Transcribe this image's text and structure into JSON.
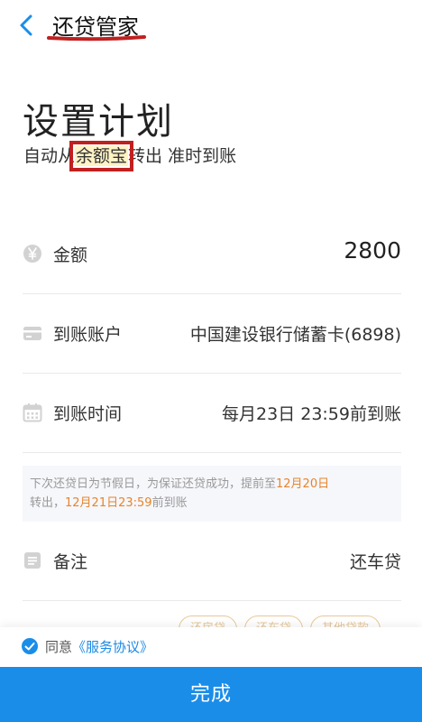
{
  "nav": {
    "back_icon": "chevron-left-icon",
    "title": "还贷管家"
  },
  "heading": "设置计划",
  "subheading": {
    "before": "自动从",
    "highlight": "余额宝",
    "after": "转出 准时到账"
  },
  "rows": [
    {
      "icon": "yen-icon",
      "label": "金额",
      "value": "2800"
    },
    {
      "icon": "card-icon",
      "label": "到账账户",
      "value": "中国建设银行储蓄卡(6898)"
    },
    {
      "icon": "calendar-icon",
      "label": "到账时间",
      "value": "每月23日 23:59前到账"
    }
  ],
  "notice": {
    "part1": "下次还贷日为节假日，为保证还贷成功，提前至",
    "date1": "12月20日",
    "part2": "转出，",
    "date2": "12月21日23:59",
    "part3": "前到账"
  },
  "remark": {
    "icon": "note-icon",
    "label": "备注",
    "value": "还车贷"
  },
  "chips": [
    "还房贷",
    "还车贷",
    "其他贷款"
  ],
  "agreement": {
    "prefix": "同意",
    "link": "《服务协议》"
  },
  "done_button": "完成",
  "colors": {
    "primary": "#1a8de9",
    "highlight": "#e6842a",
    "annotation_red": "#c0201f"
  }
}
